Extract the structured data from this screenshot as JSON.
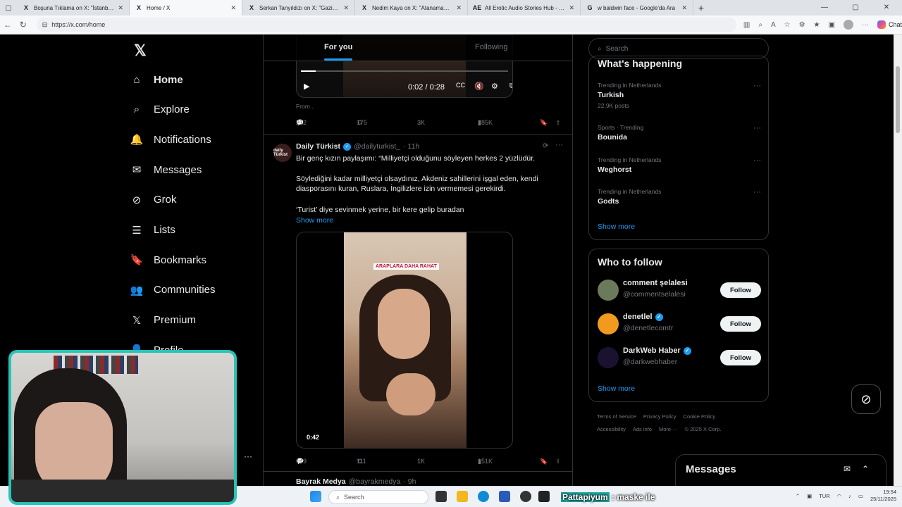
{
  "browser": {
    "tabs": [
      {
        "title": "Boşuna Tıklama on X: \"İstanbul'da",
        "favicon": "X"
      },
      {
        "title": "Home / X",
        "favicon": "X",
        "active": true
      },
      {
        "title": "Serkan Tanyıldızı on X: \"Gaziosma",
        "favicon": "X"
      },
      {
        "title": "Nedim Kaya on X: \"Atanamadım ö",
        "favicon": "X"
      },
      {
        "title": "All Erotic Audio Stories Hub - Lite",
        "favicon": "AE"
      },
      {
        "title": "w baldwin face - Google'da Ara",
        "favicon": "G"
      }
    ],
    "url": "https://x.com/home",
    "chat_label": "Chat"
  },
  "nav": {
    "items": [
      {
        "label": "Home",
        "icon": "home-icon"
      },
      {
        "label": "Explore",
        "icon": "search-icon"
      },
      {
        "label": "Notifications",
        "icon": "bell-icon"
      },
      {
        "label": "Messages",
        "icon": "mail-icon"
      },
      {
        "label": "Grok",
        "icon": "grok-icon"
      },
      {
        "label": "Lists",
        "icon": "list-icon"
      },
      {
        "label": "Bookmarks",
        "icon": "bookmark-icon"
      },
      {
        "label": "Communities",
        "icon": "people-icon"
      },
      {
        "label": "Premium",
        "icon": "x-icon"
      },
      {
        "label": "Profile",
        "icon": "person-icon"
      }
    ]
  },
  "timeline": {
    "tabs": [
      "For you",
      "Following"
    ],
    "video1": {
      "time": "0:02 / 0:28",
      "progress": 0.07
    },
    "from_label": "From .",
    "post1_stats": {
      "replies": "212",
      "reposts": "175",
      "likes": "3K",
      "views": "285K"
    },
    "post2": {
      "name": "Daily Türkist",
      "handle": "@dailyturkist_",
      "time": "· 11h",
      "avatar_text": "daily Türkist",
      "line1": "Bir genç kızın paylaşımı: “Milliyetçi olduğunu söyleyen herkes 2 yüzlüdür.",
      "line2": "Söylediğini kadar milliyetçi olsaydınız, Akdeniz sahillerini işgal eden, kendi diasporasını kuran, Ruslara, İngilizlere izin vermemesi gerekirdi.",
      "line3": "‘Turist’ diye sevinmek yerine, bir kere gelip buradan",
      "show_more": "Show more",
      "video_caption": "ARAPLARA DAHA RAHAT",
      "video_duration": "0:42",
      "stats": {
        "replies": "149",
        "reposts": "111",
        "likes": "1K",
        "views": "151K"
      }
    },
    "post3_partial": {
      "name": "Bayrak Medya",
      "handle": "@bayrakmedya",
      "time": "· 9h"
    }
  },
  "right": {
    "search_placeholder": "Search",
    "whats_happening": "What's happening",
    "trends": [
      {
        "context": "Trending in Netherlands",
        "name": "Turkish",
        "count": "22.9K posts"
      },
      {
        "context": "Sports · Trending",
        "name": "Bounida",
        "count": ""
      },
      {
        "context": "Trending in Netherlands",
        "name": "Weghorst",
        "count": ""
      },
      {
        "context": "Trending in Netherlands",
        "name": "Godts",
        "count": ""
      }
    ],
    "show_more": "Show more",
    "who_to_follow": "Who to follow",
    "follow_list": [
      {
        "name": "comment şelalesi",
        "handle": "@commentselalesi",
        "verified": false,
        "color": "#6b7a5a"
      },
      {
        "name": "denetlel",
        "handle": "@denetlecomtr",
        "verified": true,
        "color": "#f29a1f"
      },
      {
        "name": "DarkWeb Haber",
        "handle": "@darkwebhaber",
        "verified": true,
        "color": "#1b1230"
      }
    ],
    "follow_label": "Follow",
    "show_more_2": "Show more",
    "footer": [
      "Terms of Service",
      "Privacy Policy",
      "Cookie Policy",
      "Accessibility",
      "Ads info",
      "More ···",
      "© 2025 X Corp."
    ]
  },
  "messages_drawer": {
    "title": "Messages"
  },
  "taskbar": {
    "search": "Search",
    "caption_highlight": "Pattapiyum",
    "caption_rest": ": maske ile",
    "lang": "TUR",
    "time": "19:54",
    "date": "25/11/2025"
  }
}
